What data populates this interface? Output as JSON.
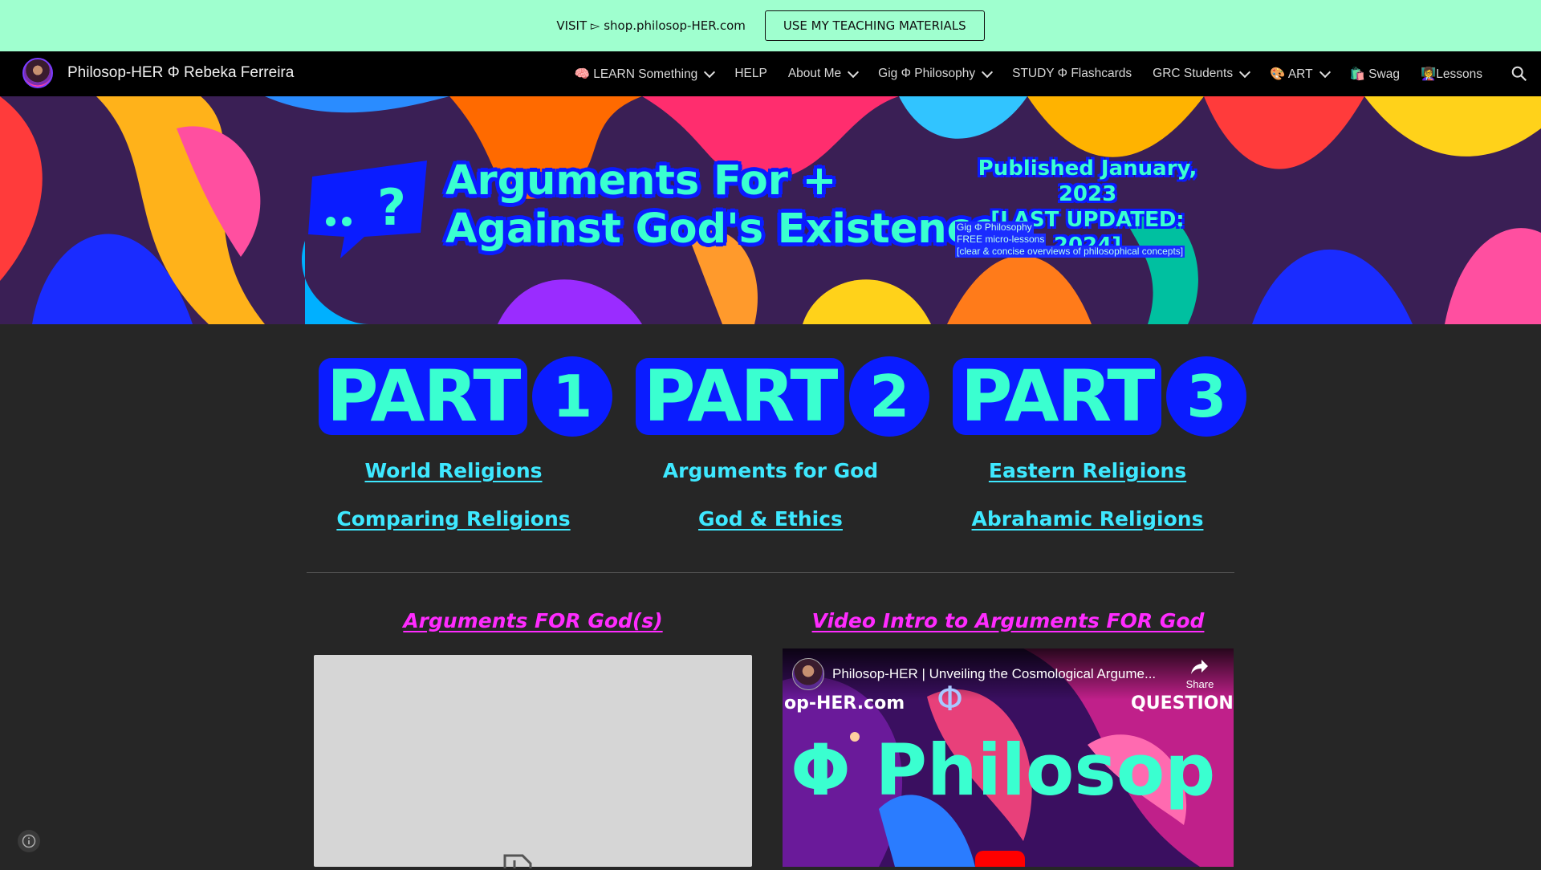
{
  "banner": {
    "text": "VISIT ▻ shop.philosop-HER.com",
    "button_label": "USE MY TEACHING MATERIALS"
  },
  "nav": {
    "site_title": "Philosop-HER Φ Rebeka Ferreira",
    "items": [
      {
        "label": "🧠 LEARN Something",
        "dropdown": true
      },
      {
        "label": "HELP",
        "dropdown": false
      },
      {
        "label": "About Me",
        "dropdown": true
      },
      {
        "label": "Gig Φ Philosophy",
        "dropdown": true
      },
      {
        "label": "STUDY Φ Flashcards",
        "dropdown": false
      },
      {
        "label": "GRC Students",
        "dropdown": true
      },
      {
        "label": "🎨 ART",
        "dropdown": true
      },
      {
        "label": "🛍️ Swag",
        "dropdown": false
      },
      {
        "label": "👩‍🏫Lessons",
        "dropdown": false
      }
    ],
    "search_icon": "search-icon"
  },
  "hero": {
    "title_line1": "Arguments For +",
    "title_line2": "Against God's Existence",
    "published": "Published January, 2023",
    "updated": "[LAST UPDATED: 2024]",
    "note_line1": "Gig Φ Philosophy",
    "note_line2": "FREE micro-lessons",
    "note_line3": "[clear & concise overviews of philosophical concepts]"
  },
  "parts": [
    {
      "word": "PART",
      "number": "1",
      "links": [
        "World Religions",
        "Comparing Religions"
      ]
    },
    {
      "word": "PART",
      "number": "2",
      "links": [
        "Arguments for God",
        "God & Ethics"
      ]
    },
    {
      "word": "PART",
      "number": "3",
      "links": [
        "Eastern Religions",
        "Abrahamic Religions"
      ]
    }
  ],
  "sections": {
    "left_heading": "Arguments FOR God(s)",
    "right_heading": "Video Intro to Arguments FOR God"
  },
  "video": {
    "title": "Philosop-HER | Unveiling the Cosmological Argume...",
    "share_label": "Share",
    "thumb_big": "Φ Philosop",
    "thumb_left": "op-HER.com",
    "thumb_right": "QUESTION I",
    "thumb_phi": "Φ"
  },
  "colors": {
    "banner_bg": "#9fffcf",
    "accent_mint": "#3affd0",
    "accent_blue": "#0a1cff",
    "link_cyan": "#3ee8ff",
    "heading_magenta": "#ff2bff"
  }
}
